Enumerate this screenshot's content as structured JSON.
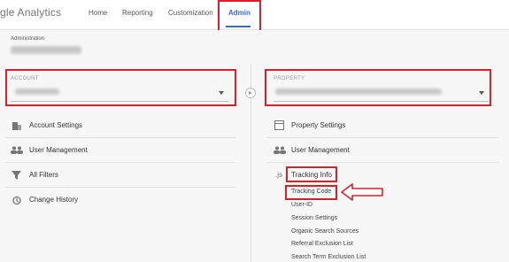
{
  "topbar": {
    "brand": "gle Analytics",
    "nav": [
      "Home",
      "Reporting",
      "Customization",
      "Admin"
    ]
  },
  "admin": {
    "heading": "Administration"
  },
  "account": {
    "label": "ACCOUNT",
    "items": [
      "Account Settings",
      "User Management",
      "All Filters",
      "Change History"
    ]
  },
  "property": {
    "label": "PROPERTY",
    "items": [
      "Property Settings",
      "User Management",
      "Tracking Info"
    ],
    "tracking_sub": [
      "Tracking Code",
      "User-ID",
      "Session Settings",
      "Organic Search Sources",
      "Referral Exclusion List",
      "Search Term Exclusion List"
    ],
    "js_badge": ".js"
  },
  "colors": {
    "accent": "#3367d6",
    "highlight": "#d6202b",
    "arrow_fill": "#ffffff"
  }
}
